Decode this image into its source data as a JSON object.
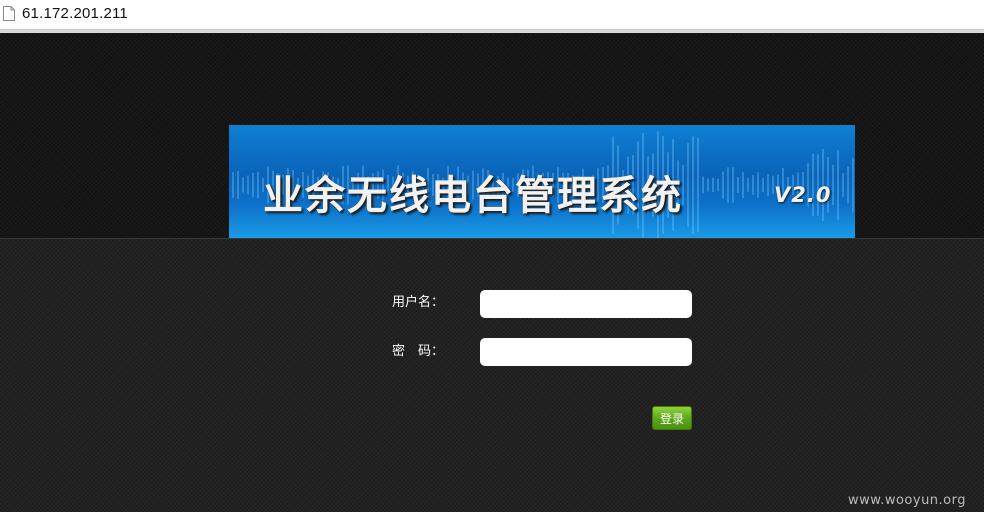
{
  "browser": {
    "url": "61.172.201.211",
    "page_icon": "document-icon"
  },
  "banner": {
    "title": "业余无线电台管理系统",
    "version": "V2.0"
  },
  "login_form": {
    "username_label": "用户名：",
    "username_value": "",
    "password_label": "密　码：",
    "password_value": "",
    "submit_label": "登录"
  },
  "watermark": "www.wooyun.org",
  "colors": {
    "banner_blue": "#0a63b8",
    "button_green": "#5fa81c",
    "background_dark": "#1c1c1c"
  }
}
